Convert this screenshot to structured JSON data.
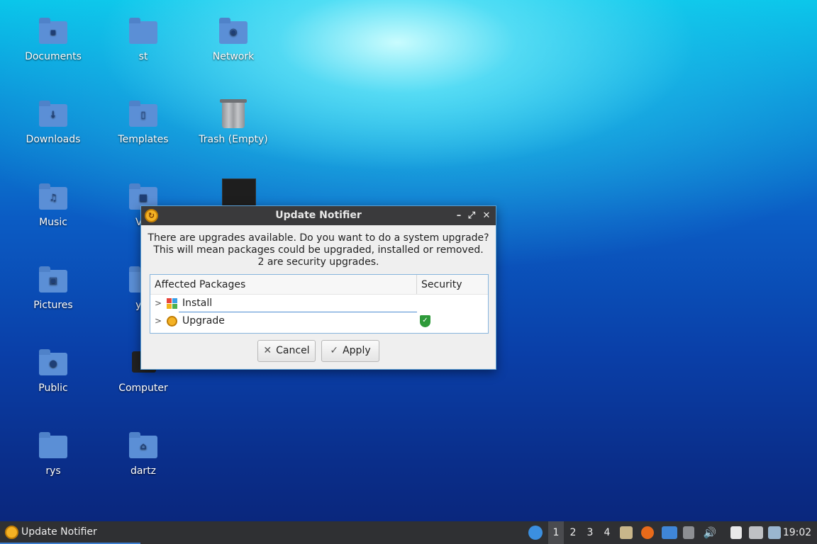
{
  "desktop": {
    "icons": [
      {
        "label": "Documents",
        "icon": "folder-documents-icon",
        "mark": "▪"
      },
      {
        "label": "st",
        "icon": "folder-icon",
        "mark": ""
      },
      {
        "label": "Network",
        "icon": "network-icon",
        "mark": "◉"
      },
      {
        "label": "Downloads",
        "icon": "folder-downloads-icon",
        "mark": "↓"
      },
      {
        "label": "Templates",
        "icon": "folder-templates-icon",
        "mark": "▯"
      },
      {
        "label": "Trash (Empty)",
        "icon": "trash-icon",
        "mark": ""
      },
      {
        "label": "Music",
        "icon": "folder-music-icon",
        "mark": "♫"
      },
      {
        "label": "Vid",
        "icon": "folder-videos-icon",
        "mark": "■"
      },
      {
        "label": "Pictures",
        "icon": "folder-pictures-icon",
        "mark": "▣"
      },
      {
        "label": "yaf",
        "icon": "folder-icon",
        "mark": ""
      },
      {
        "label": "Public",
        "icon": "folder-public-icon",
        "mark": "●"
      },
      {
        "label": "Computer",
        "icon": "computer-icon",
        "mark": ""
      },
      {
        "label": "rys",
        "icon": "folder-icon",
        "mark": ""
      },
      {
        "label": "dartz",
        "icon": "folder-home-icon",
        "mark": "⌂"
      }
    ]
  },
  "dialog": {
    "title": "Update Notifier",
    "message_lines": [
      "There are upgrades available. Do you want to do a system upgrade?",
      "This will mean packages could be upgraded, installed or removed.",
      "2 are security upgrades."
    ],
    "columns": [
      "Affected Packages",
      "Security"
    ],
    "rows": [
      {
        "label": "Install",
        "icon": "install-icon",
        "security": false
      },
      {
        "label": "Upgrade",
        "icon": "upgrade-icon",
        "security": true
      }
    ],
    "buttons": {
      "cancel": "Cancel",
      "apply": "Apply"
    },
    "controls": {
      "minimize": "–",
      "maximize": "⤢",
      "close": "✕"
    }
  },
  "taskbar": {
    "task_label": "Update Notifier",
    "workspaces": [
      "1",
      "2",
      "3",
      "4"
    ],
    "active_workspace": "1",
    "clock": "19:02"
  }
}
